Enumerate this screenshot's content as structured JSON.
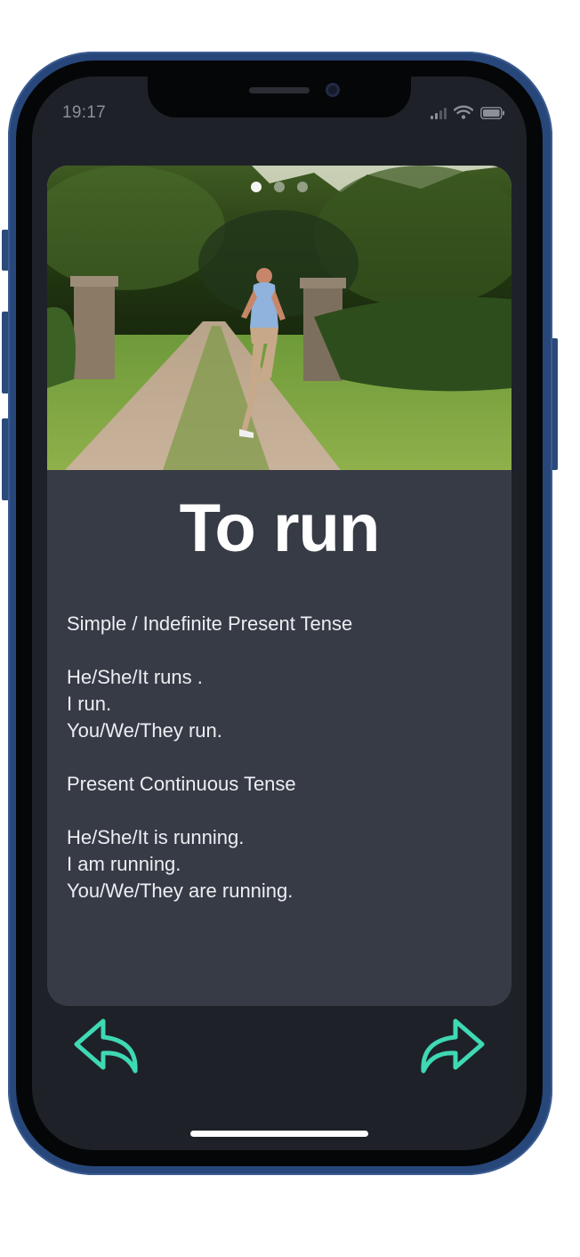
{
  "status_bar": {
    "time": "19:17",
    "icons": [
      "signal-icon",
      "wifi-icon",
      "battery-icon"
    ]
  },
  "card": {
    "pager": {
      "total": 3,
      "active": 0
    },
    "verb_title": "To run",
    "sections": [
      {
        "heading": "Simple / Indefinite Present Tense",
        "lines": [
          "He/She/It runs .",
          "I run.",
          "You/We/They run."
        ]
      },
      {
        "heading": "Present Continuous Tense",
        "lines": [
          "He/She/It is running.",
          "I am running.",
          "You/We/They are running."
        ]
      }
    ]
  },
  "navigation": {
    "back_icon": "back-arrow-icon",
    "forward_icon": "forward-arrow-icon"
  },
  "colors": {
    "screen_bg": "#1e2228",
    "card_bg": "#373b45",
    "accent": "#3fd9b4",
    "frame": "#27467a"
  }
}
